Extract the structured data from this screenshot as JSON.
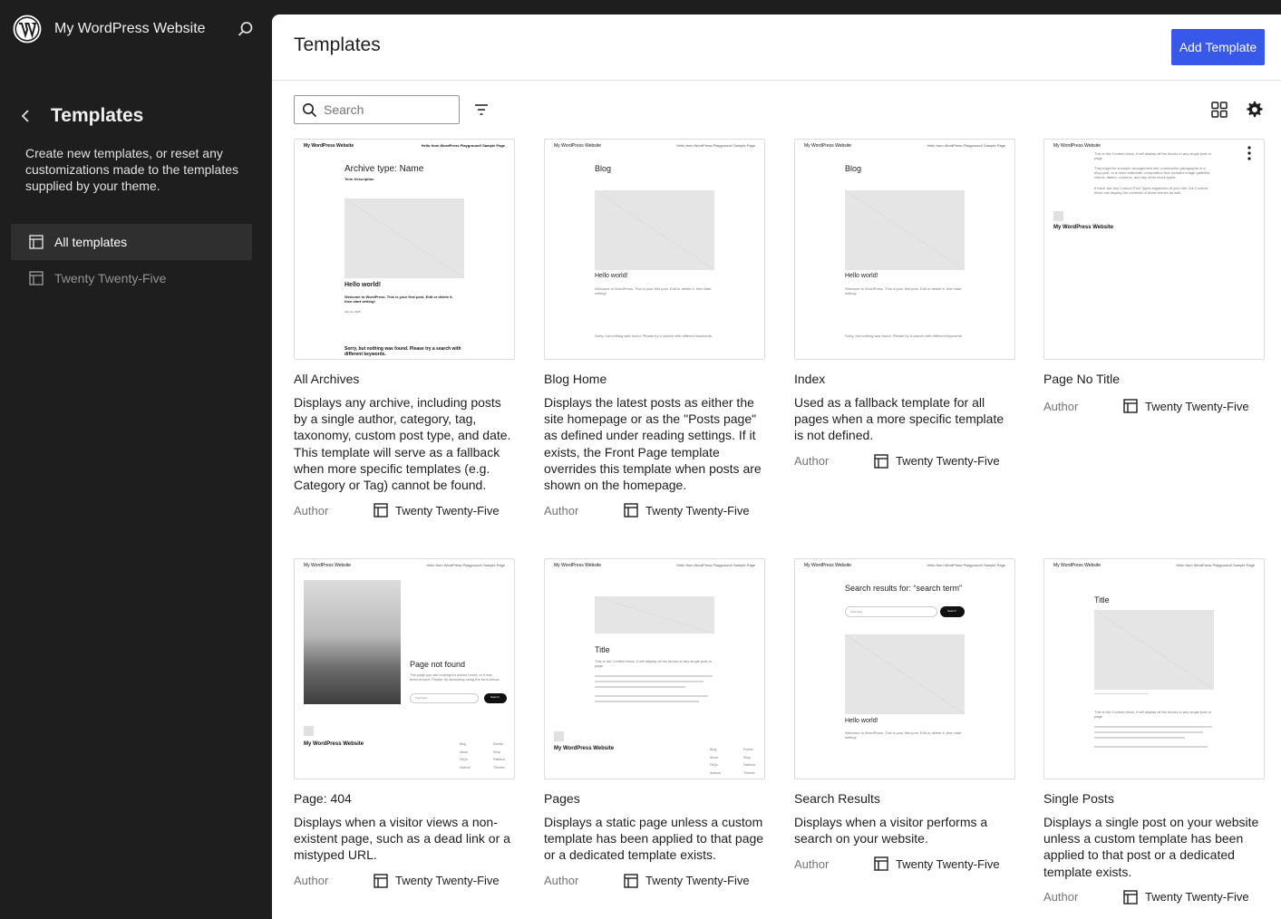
{
  "sidebar": {
    "site_title": "My WordPress Website",
    "title": "Templates",
    "description": "Create new templates, or reset any customizations made to the templates supplied by your theme.",
    "items": [
      {
        "label": "All templates"
      },
      {
        "label": "Twenty Twenty-Five"
      }
    ]
  },
  "main": {
    "title": "Templates",
    "add_button": "Add Template",
    "search_placeholder": "Search"
  },
  "cards": [
    {
      "title": "All Archives",
      "desc": "Displays any archive, including posts by a single author, category, tag, taxonomy, custom post type, and date. This template will serve as a fallback when more specific templates (e.g. Category or Tag) cannot be found.",
      "author": "Author",
      "theme": "Twenty Twenty-Five",
      "preview": {
        "site": "My WordPress Website",
        "nav": "Hello from WordPress Playground!   Sample Page",
        "heading": "Archive type: Name",
        "sub": "Term Description",
        "post": "Hello world!",
        "excerpt": "Welcome to WordPress. This is your first post. Edit or delete it, then start writing!",
        "date": "July 11, 2025",
        "footer": "Sorry, but nothing was found. Please try a search with different keywords."
      }
    },
    {
      "title": "Blog Home",
      "desc": "Displays the latest posts as either the site homepage or as the \"Posts page\" as defined under reading settings. If it exists, the Front Page template overrides this template when posts are shown on the homepage.",
      "author": "Author",
      "theme": "Twenty Twenty-Five",
      "preview": {
        "site": "My WordPress Website",
        "nav": "Hello from WordPress Playground!   Sample Page",
        "heading": "Blog",
        "post": "Hello world!",
        "excerpt": "Welcome to WordPress. This is your first post. Edit or delete it, then start writing!",
        "footer": "Sorry, but nothing was found. Please try a search with different keywords."
      }
    },
    {
      "title": "Index",
      "desc": "Used as a fallback template for all pages when a more specific template is not defined.",
      "author": "Author",
      "theme": "Twenty Twenty-Five",
      "preview": {
        "site": "My WordPress Website",
        "nav": "Hello from WordPress Playground!   Sample Page",
        "heading": "Blog",
        "post": "Hello world!",
        "excerpt": "Welcome to WordPress. This is your first post. Edit or delete it, then start writing!",
        "footer": "Sorry, but nothing was found. Please try a search with different keywords."
      }
    },
    {
      "title": "Page No Title",
      "desc": "",
      "author": "Author",
      "theme": "Twenty Twenty-Five",
      "preview": {
        "site": "My WordPress Website",
        "nav": "Hello from WordPress Playground!   Sample Page",
        "body1": "This is the Content block, it will display all the blocks in any single post or page.",
        "body2": "That might be a simple arrangement like consecutive paragraphs in a blog post, or a more elaborate composition that includes image galleries, videos, tables, columns, and any other block types.",
        "body3": "If there are any Custom Post Types registered at your site, the Content block can display the contents of those entries as well.",
        "footsite": "My WordPress Website"
      }
    },
    {
      "title": "Page: 404",
      "desc": "Displays when a visitor views a non-existent page, such as a dead link or a mistyped URL.",
      "author": "Author",
      "theme": "Twenty Twenty-Five",
      "preview": {
        "site": "My WordPress Website",
        "nav": "Hello from WordPress Playground!   Sample Page",
        "heading": "Page not found",
        "excerpt": "The page you are looking for doesn't exist, or it has been moved. Please try searching using the form below.",
        "input": "Type here",
        "btn": "Search",
        "footsite": "My WordPress Website",
        "links1": "Blog\nAbout\nFAQs\nAuthors",
        "links2": "Events\nShop\nPatterns\nThemes"
      }
    },
    {
      "title": "Pages",
      "desc": "Displays a static page unless a custom template has been applied to that page or a dedicated template exists.",
      "author": "Author",
      "theme": "Twenty Twenty-Five",
      "preview": {
        "site": "My WordPress Website",
        "nav": "Hello from WordPress Playground!   Sample Page",
        "heading": "Title",
        "body1": "This is the Content block, it will display all the blocks in any single post or page.",
        "footsite": "My WordPress Website",
        "links1": "Blog\nAbout\nFAQs\nAuthors",
        "links2": "Events\nShop\nPatterns\nThemes"
      }
    },
    {
      "title": "Search Results",
      "desc": "Displays when a visitor performs a search on your website.",
      "author": "Author",
      "theme": "Twenty Twenty-Five",
      "preview": {
        "site": "My WordPress Website",
        "nav": "Hello from WordPress Playground!   Sample Page",
        "heading": "Search results for: “search term”",
        "input": "Type here",
        "btn": "Search",
        "post": "Hello world!",
        "excerpt": "Welcome to WordPress. This is your first post. Edit or delete it, then start writing!"
      }
    },
    {
      "title": "Single Posts",
      "desc": "Displays a single post on your website unless a custom template has been applied to that post or a dedicated template exists.",
      "author": "Author",
      "theme": "Twenty Twenty-Five",
      "preview": {
        "site": "My WordPress Website",
        "nav": "Hello from WordPress Playground!   Sample Page",
        "heading": "Title",
        "body1": "This is the Content block, it will display all the blocks in any single post or page."
      }
    }
  ]
}
